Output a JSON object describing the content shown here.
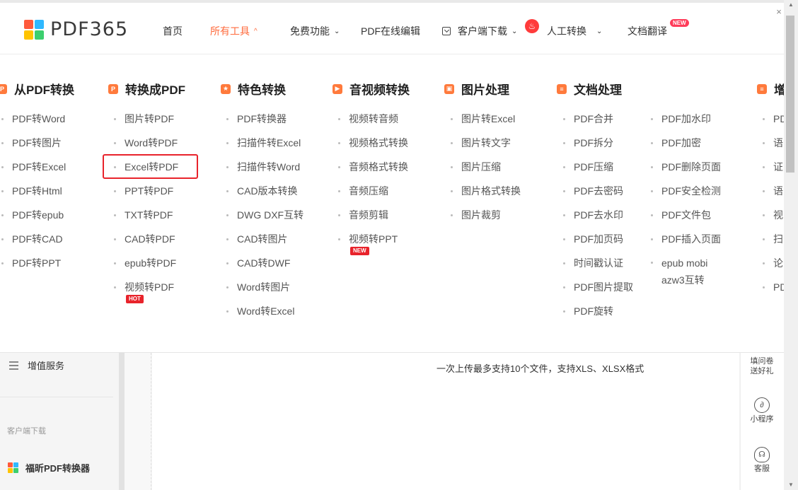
{
  "header": {
    "logo_text": "PDF365",
    "nav": [
      {
        "label": "首页"
      },
      {
        "label": "所有工具",
        "caret": "^"
      },
      {
        "label": "免费功能",
        "caret": "⌄"
      },
      {
        "label": "PDF在线编辑"
      },
      {
        "label": "客户端下载",
        "caret": "⌄"
      },
      {
        "label": "人工转换",
        "caret": "⌄"
      },
      {
        "label": "文档翻译",
        "badge": "NEW"
      }
    ],
    "close_label": "×"
  },
  "menu": {
    "columns": [
      {
        "title": "从PDF转换",
        "icon": "pdf-convert-icon",
        "items": [
          "PDF转Word",
          "PDF转图片",
          "PDF转Excel",
          "PDF转Html",
          "PDF转epub",
          "PDF转CAD",
          "PDF转PPT"
        ]
      },
      {
        "title": "转换成PDF",
        "icon": "to-pdf-icon",
        "items": [
          "图片转PDF",
          "Word转PDF",
          "Excel转PDF",
          "PPT转PDF",
          "TXT转PDF",
          "CAD转PDF",
          "epub转PDF",
          "视频转PDF"
        ],
        "tag": "HOT"
      },
      {
        "title": "特色转换",
        "icon": "star-shield-icon",
        "items": [
          "PDF转换器",
          "扫描件转Excel",
          "扫描件转Word",
          "CAD版本转换",
          "DWG DXF互转",
          "CAD转图片",
          "CAD转DWF",
          "Word转图片",
          "Word转Excel"
        ]
      },
      {
        "title": "音视频转换",
        "icon": "media-icon",
        "items": [
          "视频转音频",
          "视频格式转换",
          "音频格式转换",
          "音频压缩",
          "音频剪辑",
          "视频转PPT"
        ],
        "tag": "NEW"
      },
      {
        "title": "图片处理",
        "icon": "image-icon",
        "items": [
          "图片转Excel",
          "图片转文字",
          "图片压缩",
          "图片格式转换",
          "图片裁剪"
        ]
      },
      {
        "title": "文档处理",
        "icon": "document-icon",
        "items": [
          "PDF合并",
          "PDF拆分",
          "PDF压缩",
          "PDF去密码",
          "PDF去水印",
          "PDF加页码",
          "时间戳认证",
          "PDF图片提取",
          "PDF旋转"
        ]
      },
      {
        "title": "",
        "icon": "",
        "items": [
          "PDF加水印",
          "PDF加密",
          "PDF删除页面",
          "PDF安全检测",
          "PDF文件包",
          "PDF插入页面",
          "epub mobi azw3互转"
        ]
      },
      {
        "title": "增",
        "icon": "list-icon",
        "items": [
          "PD",
          "语",
          "证",
          "语",
          "视",
          "扫",
          "论",
          "PD"
        ]
      }
    ]
  },
  "sidebar": {
    "value_added": "增值服务",
    "client_download": "客户端下载",
    "fox_app": "福昕PDF转换器"
  },
  "main": {
    "upload_hint": "一次上传最多支持10个文件，支持XLS、XLSX格式"
  },
  "right_rail": {
    "survey": "填问卷送好礼",
    "mini_program": "小程序",
    "support": "客服"
  }
}
